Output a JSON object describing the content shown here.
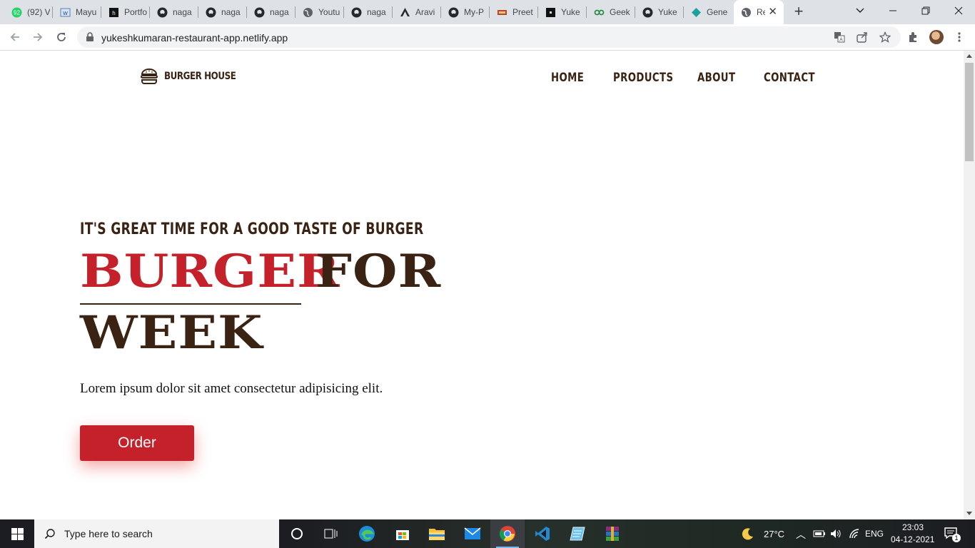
{
  "browser": {
    "tabs": [
      {
        "title": "(92) V",
        "icon": "whatsapp-icon"
      },
      {
        "title": "Mayu",
        "icon": "page-icon"
      },
      {
        "title": "Portfo",
        "icon": "portfolio-icon"
      },
      {
        "title": "naga",
        "icon": "github-icon"
      },
      {
        "title": "naga",
        "icon": "github-icon"
      },
      {
        "title": "naga",
        "icon": "github-icon"
      },
      {
        "title": "Youtu",
        "icon": "globe-icon"
      },
      {
        "title": "naga",
        "icon": "github-icon"
      },
      {
        "title": "Aravi",
        "icon": "angular-icon"
      },
      {
        "title": "My-P",
        "icon": "github-icon"
      },
      {
        "title": "Preet",
        "icon": "food-icon"
      },
      {
        "title": "Yuke",
        "icon": "dark-square-icon"
      },
      {
        "title": "Geek",
        "icon": "geeks-icon"
      },
      {
        "title": "Yuke",
        "icon": "github-icon"
      },
      {
        "title": "Gene",
        "icon": "diamond-icon"
      }
    ],
    "active_tab": {
      "title": "Re",
      "icon": "globe-icon"
    },
    "url": "yukeshkumaran-restaurant-app.netlify.app"
  },
  "site": {
    "logo_text": "BURGER HOUSE",
    "nav": [
      "HOME",
      "PRODUCTS",
      "ABOUT",
      "CONTACT"
    ],
    "hero": {
      "tagline": "IT'S GREAT TIME FOR A GOOD TASTE OF BURGER",
      "title_word1": "BURGER",
      "title_word2": "FOR",
      "title_word3": "WEEK",
      "description": "Lorem ipsum dolor sit amet consectetur adipisicing elit.",
      "order_label": "Order"
    },
    "colors": {
      "brand_red": "#c4212a",
      "brand_brown": "#3b2314"
    }
  },
  "taskbar": {
    "search_placeholder": "Type here to search",
    "apps": [
      "task-view-icon",
      "edge-icon",
      "store-icon",
      "file-explorer-icon",
      "mail-icon",
      "chrome-icon",
      "vscode-icon",
      "notepad-icon",
      "winrar-icon"
    ],
    "weather": "27°C",
    "language": "ENG",
    "time": "23:03",
    "date": "04-12-2021",
    "notification_count": "1"
  }
}
